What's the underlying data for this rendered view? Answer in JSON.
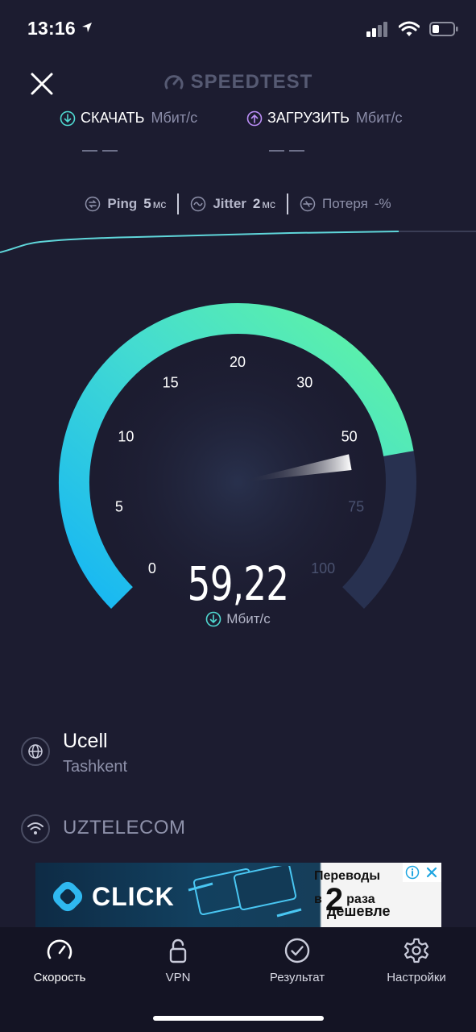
{
  "status": {
    "time": "13:16"
  },
  "header": {
    "brand": "SPEEDTEST"
  },
  "download": {
    "label": "СКАЧАТЬ",
    "unit": "Мбит/с"
  },
  "upload": {
    "label": "ЗАГРУЗИТЬ",
    "unit": "Мбит/с"
  },
  "metrics": {
    "ping": {
      "label": "Ping",
      "value": "5",
      "unit": "мс"
    },
    "jitter": {
      "label": "Jitter",
      "value": "2",
      "unit": "мс"
    },
    "loss": {
      "label": "Потеря",
      "value": "-%"
    }
  },
  "gauge": {
    "ticks": [
      "0",
      "5",
      "10",
      "15",
      "20",
      "30",
      "50",
      "75",
      "100"
    ],
    "value": "59,22",
    "unit": "Мбит/с",
    "speed_mbps": 59.22,
    "colors": {
      "start": "#1ab8f2",
      "end": "#5cf0a4",
      "track": "#283150"
    }
  },
  "server": {
    "isp": "Ucell",
    "location": "Tashkent",
    "network": "UZTELECOM"
  },
  "ad": {
    "brand": "CLICK",
    "line1": "Переводы",
    "line2_prefix": "в",
    "line2_big": "2",
    "line2_suffix": "раза",
    "line3": "дешевле"
  },
  "tabs": [
    {
      "label": "Скорость",
      "icon": "speedometer-icon"
    },
    {
      "label": "VPN",
      "icon": "lock-icon"
    },
    {
      "label": "Результат",
      "icon": "checkmark-circle-icon"
    },
    {
      "label": "Настройки",
      "icon": "gear-icon"
    }
  ]
}
